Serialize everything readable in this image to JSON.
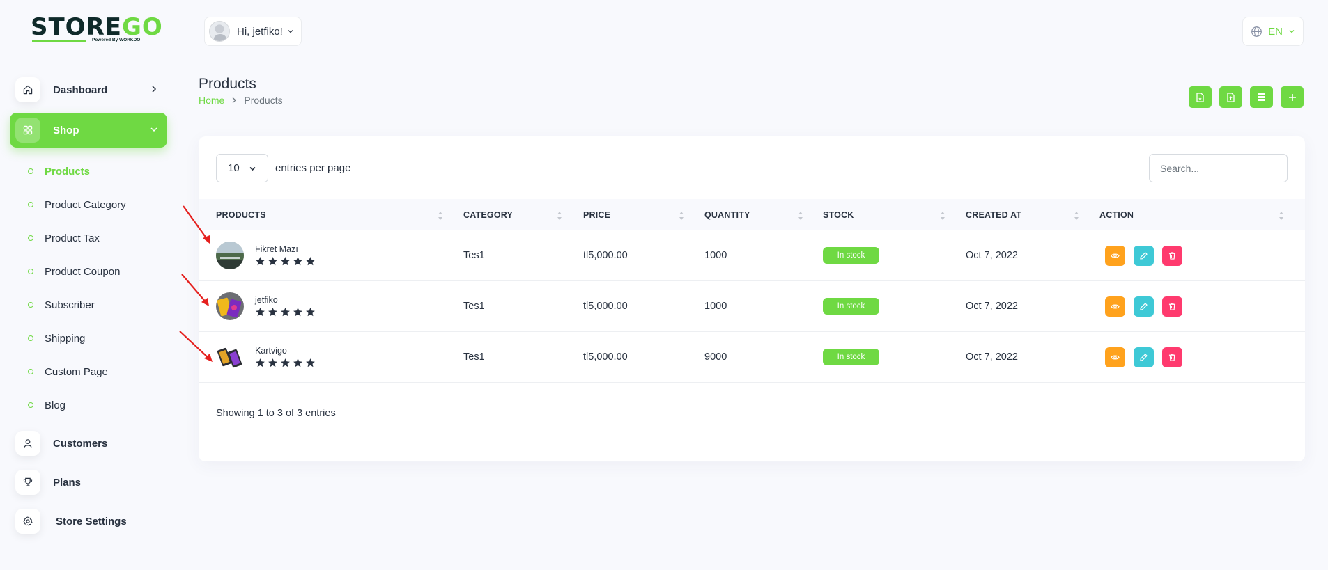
{
  "brand": {
    "logo_text_a": "STORE",
    "logo_text_b": "GO",
    "logo_sub": "Powered By WORKDO",
    "accent": "#6fd943"
  },
  "header": {
    "greeting": "Hi, jetfiko!",
    "language": "EN"
  },
  "sidebar": {
    "items": [
      {
        "label": "Dashboard",
        "icon": "home-icon"
      },
      {
        "label": "Shop",
        "icon": "grid-icon",
        "active": true
      },
      {
        "label": "Customers",
        "icon": "user-icon"
      },
      {
        "label": "Plans",
        "icon": "trophy-icon"
      },
      {
        "label": "Store Settings",
        "icon": "gear-icon"
      }
    ],
    "shop_sub": [
      "Products",
      "Product Category",
      "Product Tax",
      "Product Coupon",
      "Subscriber",
      "Shipping",
      "Custom Page",
      "Blog"
    ]
  },
  "page": {
    "title": "Products",
    "breadcrumb_home": "Home",
    "breadcrumb_current": "Products"
  },
  "table": {
    "page_size": "10",
    "entries_label": "entries per page",
    "search_placeholder": "Search...",
    "columns": [
      "PRODUCTS",
      "CATEGORY",
      "PRICE",
      "QUANTITY",
      "STOCK",
      "CREATED AT",
      "ACTION"
    ],
    "rows": [
      {
        "name": "Fikret Mazı",
        "rating": 5,
        "category": "Tes1",
        "price": "tl5,000.00",
        "quantity": "1000",
        "stock": "In stock",
        "created": "Oct 7, 2022"
      },
      {
        "name": "jetfiko",
        "rating": 5,
        "category": "Tes1",
        "price": "tl5,000.00",
        "quantity": "1000",
        "stock": "In stock",
        "created": "Oct 7, 2022"
      },
      {
        "name": "Kartvigo",
        "rating": 5,
        "category": "Tes1",
        "price": "tl5,000.00",
        "quantity": "9000",
        "stock": "In stock",
        "created": "Oct 7, 2022"
      }
    ],
    "footer": "Showing 1 to 3 of 3 entries"
  },
  "colors": {
    "view": "#ffa21d",
    "edit": "#3ec9d6",
    "delete": "#ff3a6e",
    "star": "#293240",
    "annotation_arrow": "#e5201e"
  }
}
